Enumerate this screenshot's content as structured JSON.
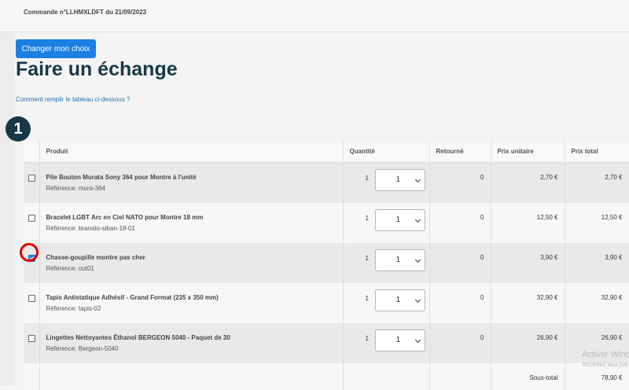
{
  "order": {
    "title": "Commande n°LLHMXLDFT du 21/09/2023"
  },
  "actions": {
    "change_choice_label": "Changer mon choix"
  },
  "page": {
    "heading": "Faire un échange",
    "help_link": "Comment remplir le tableau ci-dessous ?",
    "step_number": "1"
  },
  "table": {
    "headers": {
      "product": "Produit",
      "quantity": "Quantité",
      "returned": "Retourné",
      "unit_price": "Prix unitaire",
      "total_price": "Prix total"
    },
    "rows": [
      {
        "name": "Pile Bouton Murata Sony 364 pour Montre à l'unité",
        "ref": "Référence: mura-364",
        "qty": "1",
        "selected_qty": "1",
        "returned": "0",
        "unit_price": "2,70 €",
        "total_price": "2,70 €",
        "checked": false
      },
      {
        "name": "Bracelet LGBT Arc en Ciel NATO pour Montre 18 mm",
        "ref": "Référence: branato-siban-18-01",
        "qty": "1",
        "selected_qty": "1",
        "returned": "0",
        "unit_price": "12,50 €",
        "total_price": "12,50 €",
        "checked": false
      },
      {
        "name": "Chasse-goupille montre pas cher",
        "ref": "Référence: out01",
        "qty": "1",
        "selected_qty": "1",
        "returned": "0",
        "unit_price": "3,90 €",
        "total_price": "3,90 €",
        "checked": true
      },
      {
        "name": "Tapis Antistatique Adhésif - Grand Format (235 x 350 mm)",
        "ref": "Référence: tapis-02",
        "qty": "1",
        "selected_qty": "1",
        "returned": "0",
        "unit_price": "32,90 €",
        "total_price": "32,90 €",
        "checked": false
      },
      {
        "name": "Lingettes Nettoyantes Éthanol BERGEON 5040 - Paquet de 30",
        "ref": "Référence: Bergeon-5040",
        "qty": "1",
        "selected_qty": "1",
        "returned": "0",
        "unit_price": "26,90 €",
        "total_price": "26,90 €",
        "checked": false
      }
    ],
    "subtotal_label": "Sous-total",
    "subtotal_value": "78,90 €"
  },
  "watermark": {
    "line1": "Activer Windows",
    "line2": "Accédez aux paramètres"
  },
  "colors": {
    "accent": "#1b7fe3",
    "heading": "#173848",
    "highlight": "#e00000"
  }
}
